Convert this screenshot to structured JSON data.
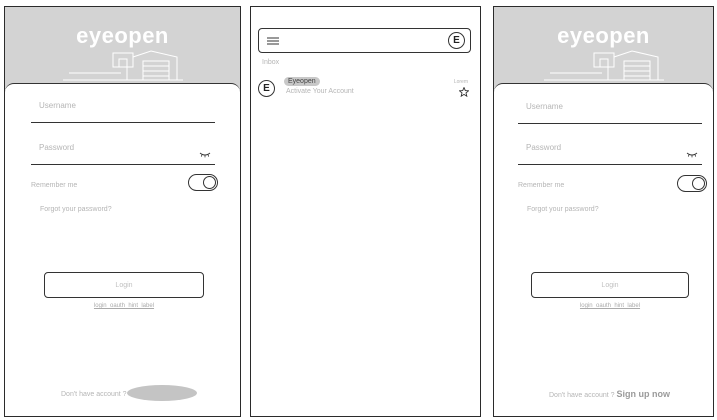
{
  "login": {
    "logo": "eyeopen",
    "username_placeholder": "Username",
    "password_placeholder": "Password",
    "remember_label": "Remember me",
    "forgot_label": "Forgot your password?",
    "login_button": "Login",
    "hint_label": "login_oauth_hint_label",
    "signup_prompt": "Don't have account ?",
    "signup_link": "Sign up now"
  },
  "inbox": {
    "avatar_letter": "E",
    "section_label": "Inbox",
    "messages": [
      {
        "sender_initial": "E",
        "sender": "Eyeopen",
        "subject": "Activate Your Account",
        "date": "Lorem"
      }
    ]
  },
  "colors": {
    "header_bg": "#d3d3d3",
    "border": "#2b2b2b",
    "placeholder": "#b5b5b5"
  }
}
